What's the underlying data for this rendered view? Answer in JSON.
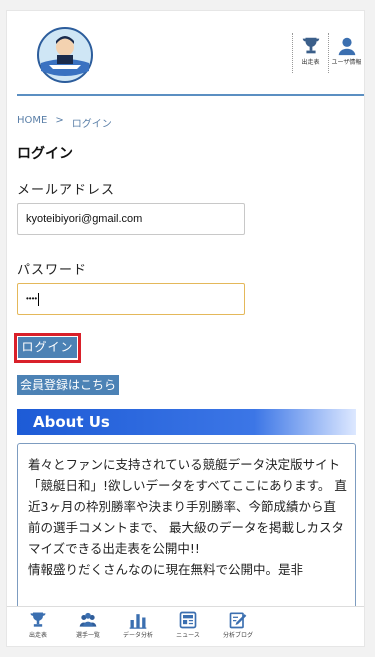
{
  "header": {
    "buttons": [
      {
        "label": "出走表",
        "icon": "trophy-icon"
      },
      {
        "label": "ユーザ情報",
        "icon": "user-icon"
      }
    ]
  },
  "breadcrumb": {
    "home": "HOME",
    "separator": ">",
    "current": "ログイン"
  },
  "page_title": "ログイン",
  "form": {
    "email_label": "メールアドレス",
    "email_value": "kyoteibiyori@gmail.com",
    "password_label": "パスワード",
    "password_value": "••••",
    "login_button": "ログイン",
    "register_button": "会員登録はこちら"
  },
  "about": {
    "title": "About Us",
    "paragraph1": "着々とファンに支持されている競艇データ決定版サイト「競艇日和」!欲しいデータをすべてここにあります。 直近3ヶ月の枠別勝率や決まり手別勝率、今節成績から直前の選手コメントまで、 最大級のデータを掲載しカスタマイズできる出走表を公開中!!",
    "paragraph2": "情報盛りだくさんなのに現在無料で公開中。是非"
  },
  "bottom_nav": [
    {
      "label": "出走表",
      "icon": "trophy-icon"
    },
    {
      "label": "選手一覧",
      "icon": "players-icon"
    },
    {
      "label": "データ分析",
      "icon": "bar-chart-icon"
    },
    {
      "label": "ニュース",
      "icon": "news-icon"
    },
    {
      "label": "分析ブログ",
      "icon": "edit-icon"
    }
  ],
  "colors": {
    "accent": "#4c82b5",
    "header_line": "#5b8fc2",
    "highlight": "#d9202a",
    "about_gradient": "#1d5bd6"
  }
}
